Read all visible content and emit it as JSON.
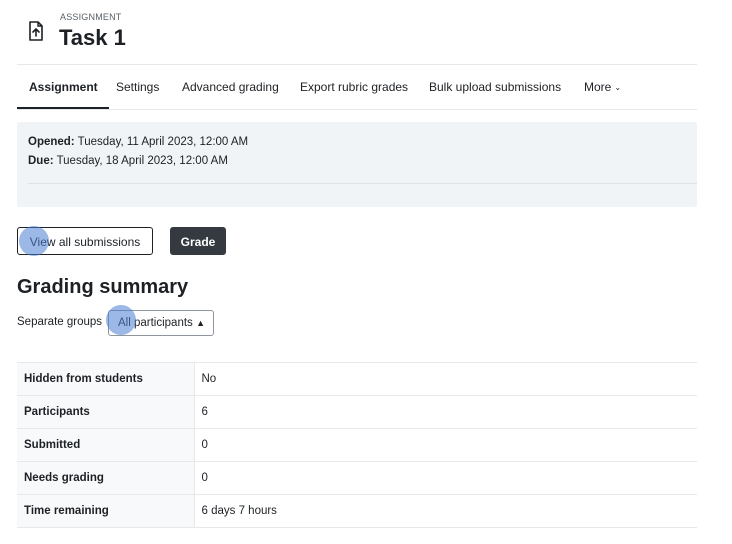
{
  "header": {
    "kicker": "ASSIGNMENT",
    "title": "Task 1",
    "icon": "file-upload-icon"
  },
  "tabs": [
    {
      "label": "Assignment",
      "active": true
    },
    {
      "label": "Settings",
      "active": false
    },
    {
      "label": "Advanced grading",
      "active": false
    },
    {
      "label": "Export rubric grades",
      "active": false
    },
    {
      "label": "Bulk upload submissions",
      "active": false
    },
    {
      "label": "More",
      "active": false,
      "icon": "chevron-down-icon"
    }
  ],
  "dates": {
    "opened_label": "Opened:",
    "opened_value": "Tuesday, 11 April 2023, 12:00 AM",
    "due_label": "Due:",
    "due_value": "Tuesday, 18 April 2023, 12:00 AM"
  },
  "actions": {
    "view_all_label": "View all submissions",
    "grade_label": "Grade"
  },
  "grading_summary": {
    "title": "Grading summary",
    "groups_label": "Separate groups",
    "groups_selected": "All participants",
    "rows": [
      {
        "label": "Hidden from students",
        "value": "No"
      },
      {
        "label": "Participants",
        "value": "6"
      },
      {
        "label": "Submitted",
        "value": "0"
      },
      {
        "label": "Needs grading",
        "value": "0"
      },
      {
        "label": "Time remaining",
        "value": "6 days 7 hours"
      }
    ]
  },
  "colors": {
    "dark_button": "#343a40",
    "dates_bg": "#f1f4f7",
    "click_marker": "#4a7dd4"
  }
}
